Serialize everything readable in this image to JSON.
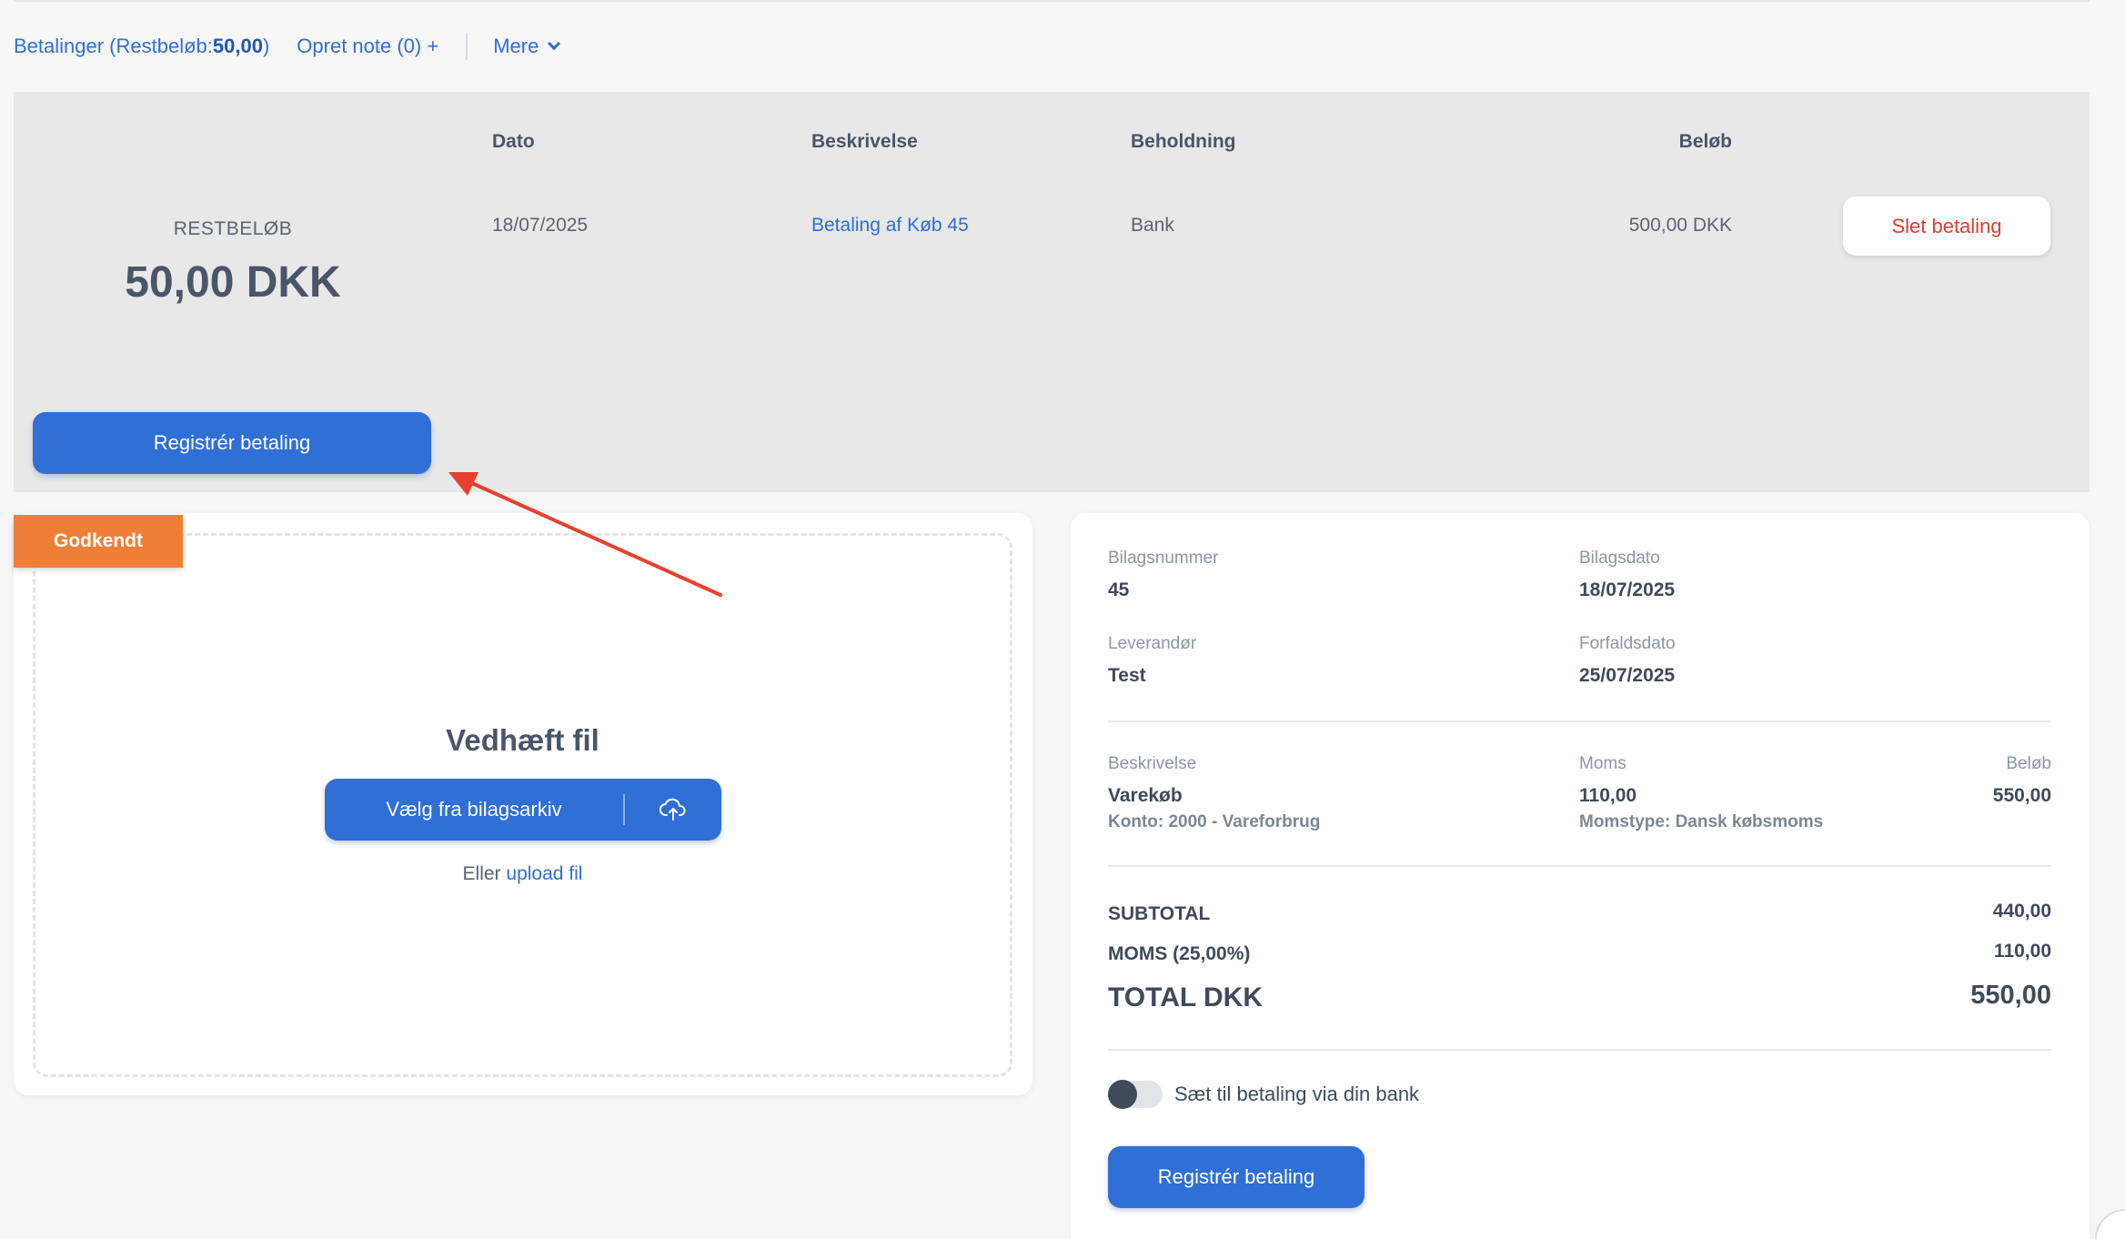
{
  "nav": {
    "payments_prefix": "Betalinger (Restbeløb: ",
    "payments_amount": "50,00",
    "payments_suffix": ")",
    "note": "Opret note (0) +",
    "more": "Mere"
  },
  "payments": {
    "headers": {
      "date": "Dato",
      "description": "Beskrivelse",
      "holding": "Beholdning",
      "amount": "Beløb"
    },
    "row": {
      "date": "18/07/2025",
      "description": "Betaling af Køb 45",
      "holding": "Bank",
      "amount": "500,00 DKK"
    },
    "rest_label": "RESTBELØB",
    "rest_value": "50,00 DKK",
    "delete_label": "Slet betaling",
    "register_label": "Registrér betaling"
  },
  "upload": {
    "badge": "Godkendt",
    "title": "Vedhæft fil",
    "archive_button": "Vælg fra bilagsarkiv",
    "alt_prefix": "Eller ",
    "alt_link": "upload fil"
  },
  "details": {
    "voucher_number_label": "Bilagsnummer",
    "voucher_number": "45",
    "voucher_date_label": "Bilagsdato",
    "voucher_date": "18/07/2025",
    "supplier_label": "Leverandør",
    "supplier": "Test",
    "due_date_label": "Forfaldsdato",
    "due_date": "25/07/2025",
    "line_description_label": "Beskrivelse",
    "line_description": "Varekøb",
    "line_account": "Konto: 2000 - Vareforbrug",
    "line_vat_label": "Moms",
    "line_vat": "110,00",
    "line_vat_type": "Momstype: Dansk købsmoms",
    "line_amount_label": "Beløb",
    "line_amount": "550,00",
    "subtotal_label": "SUBTOTAL",
    "subtotal": "440,00",
    "vat_total_label": "MOMS (25,00%)",
    "vat_total": "110,00",
    "total_label": "TOTAL DKK",
    "total": "550,00",
    "bank_toggle_label": "Sæt til betaling via din bank",
    "bank_toggle_on": false,
    "register_label": "Registrér betaling"
  },
  "colors": {
    "primary": "#2f6fd6",
    "danger": "#e03c31",
    "badge": "#ef7f37",
    "annotation_arrow": "#e8402e"
  },
  "icons": [
    "chevron-down-icon",
    "cloud-upload-icon",
    "annotation-arrow"
  ]
}
